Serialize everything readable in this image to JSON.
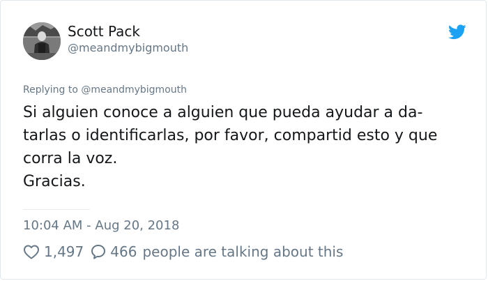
{
  "author": {
    "name": "Scott Pack",
    "handle": "@meandmybigmouth"
  },
  "reply_context": "Replying to @meandmybigmouth",
  "tweet_lines": [
    "Si alguien conoce a alguien que pueda ayudar a da-",
    "tarlas o identificarlas, por favor, compartid esto y que",
    "corra la voz.",
    "Gracias."
  ],
  "timestamp": "10:04 AM - Aug 20, 2018",
  "engagement": {
    "likes": "1,497",
    "replies": "466",
    "talking_text": "people are talking about this"
  },
  "colors": {
    "twitter_blue": "#1da1f2",
    "secondary_text": "#657786",
    "primary_text": "#14171a"
  },
  "icons": {
    "brand": "twitter-bird-icon",
    "like": "heart-icon",
    "reply": "speech-bubble-icon"
  }
}
